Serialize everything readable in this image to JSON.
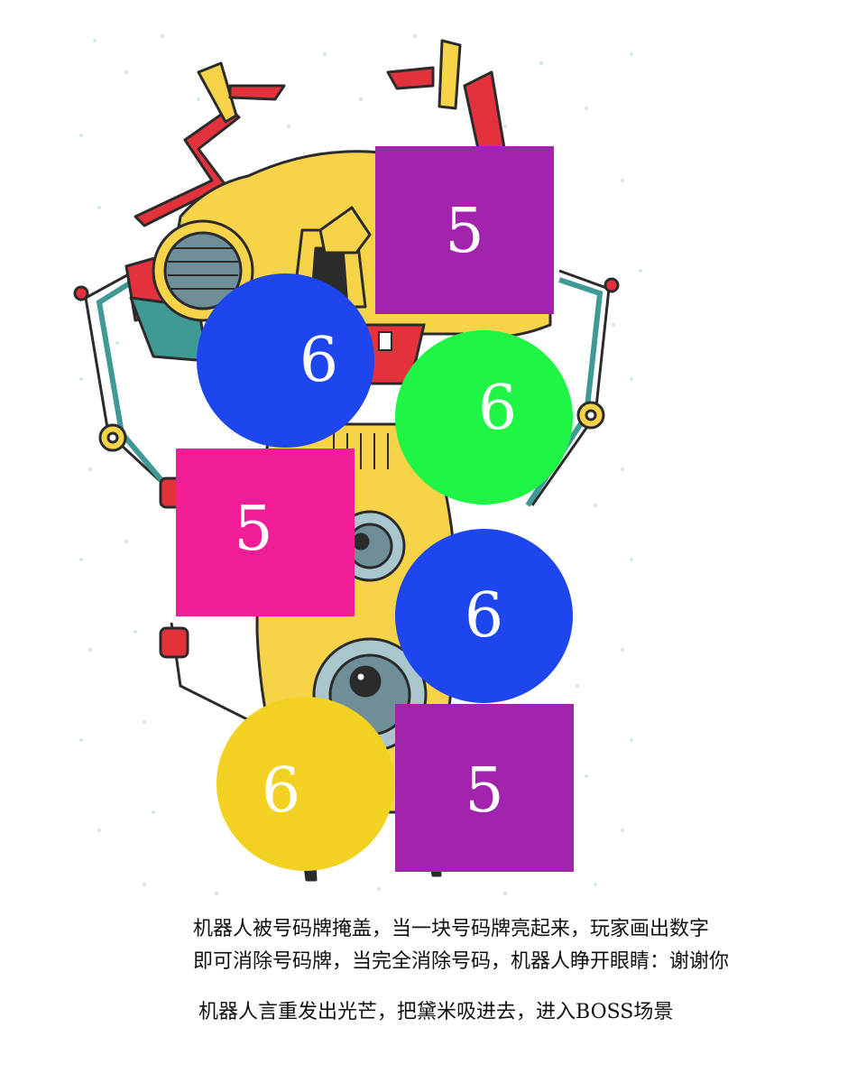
{
  "tiles": [
    {
      "id": "tile-square-purple-top",
      "shape": "square",
      "number": "5",
      "color": "#a224ad"
    },
    {
      "id": "tile-circle-blue-top",
      "shape": "circle",
      "number": "6",
      "color": "#1e46ee"
    },
    {
      "id": "tile-circle-green",
      "shape": "circle",
      "number": "6",
      "color": "#1ef544"
    },
    {
      "id": "tile-square-pink",
      "shape": "square",
      "number": "5",
      "color": "#f01d96"
    },
    {
      "id": "tile-circle-blue-bottom",
      "shape": "circle",
      "number": "6",
      "color": "#1e46ee"
    },
    {
      "id": "tile-circle-yellow",
      "shape": "circle",
      "number": "6",
      "color": "#f2d120"
    },
    {
      "id": "tile-square-purple-bottom",
      "shape": "square",
      "number": "5",
      "color": "#a224ad"
    }
  ],
  "caption": {
    "line1": "机器人被号码牌掩盖，当一块号码牌亮起来，玩家画出数字",
    "line2": "即可消除号码牌，当完全消除号码，机器人睁开眼睛：谢谢你",
    "line3": "机器人言重发出光芒，把黛米吸进去，进入BOSS场景"
  },
  "colors": {
    "robot_yellow": "#f7d34a",
    "robot_red": "#e4323c",
    "robot_teal": "#3f9a95",
    "robot_outline": "#2b2b2b",
    "speckle": "#cfe8e6"
  }
}
